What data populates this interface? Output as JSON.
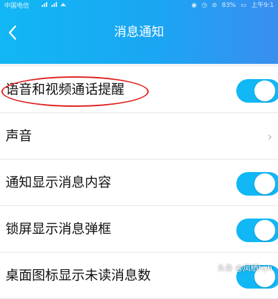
{
  "status_bar": {
    "carrier": "中国电信",
    "battery": "83%",
    "time": "上午9:1"
  },
  "header": {
    "title": "消息通知",
    "back_icon": "chevron-left-icon",
    "accent_color": "#12b7f5"
  },
  "settings": [
    {
      "label": "语音和视频通话提醒",
      "control": "toggle",
      "on": true
    },
    {
      "label": "声音",
      "control": "chevron"
    },
    {
      "label": "通知显示消息内容",
      "control": "toggle",
      "on": true
    },
    {
      "label": "锁屏显示消息弹框",
      "control": "toggle",
      "on": true
    },
    {
      "label": "桌面图标显示未读消息数",
      "control": "toggle",
      "on": true
    }
  ],
  "watermark": "头条 @凤栖hyh"
}
